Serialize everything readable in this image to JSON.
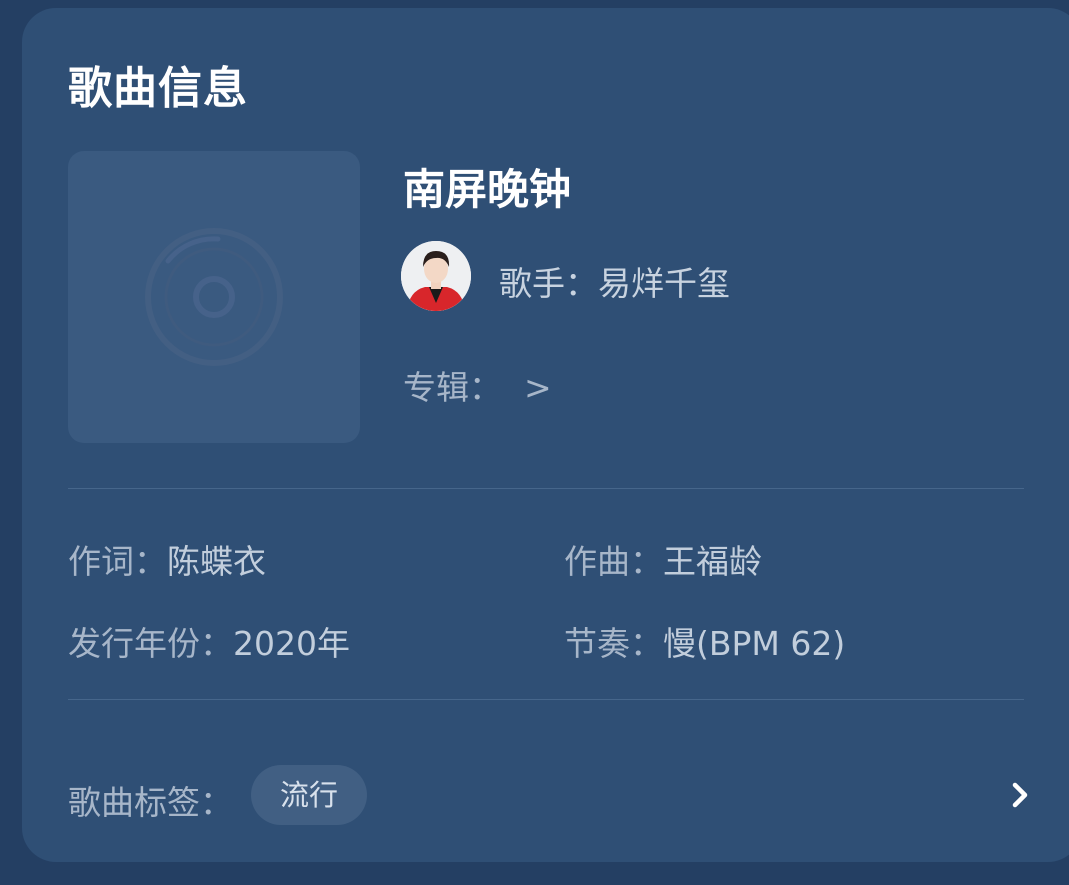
{
  "header": {
    "title": "歌曲信息"
  },
  "song": {
    "name": "南屏晚钟",
    "singer_label": "歌手：",
    "singer_name": "易烊千玺",
    "album_label": "专辑：",
    "album_arrow": ">"
  },
  "details": {
    "lyricist_label": "作词：",
    "lyricist": "陈蝶衣",
    "composer_label": "作曲：",
    "composer": "王福龄",
    "year_label": "发行年份：",
    "year": "2020年",
    "tempo_label": "节奏：",
    "tempo": "慢(BPM 62)"
  },
  "tags": {
    "label": "歌曲标签：",
    "items": [
      "流行"
    ]
  },
  "icons": {
    "cover_placeholder": "disc-icon",
    "avatar": "singer-avatar",
    "more": "chevron-right-icon"
  },
  "colors": {
    "background": "#243f63",
    "card": "#2f4f75",
    "title": "#ffffff",
    "muted_text": "#a7b6c9",
    "tag_pill": "#415f83"
  }
}
